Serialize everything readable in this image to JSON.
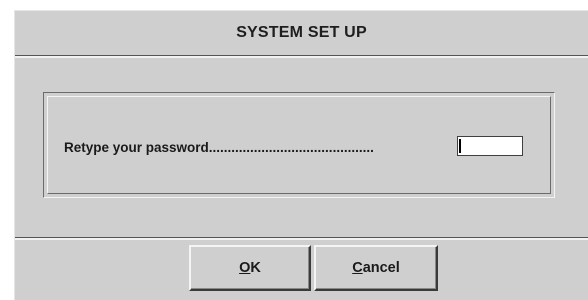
{
  "dialog": {
    "title": "SYSTEM SET UP",
    "prompt_label": "Retype your password............................................",
    "password_value": "",
    "buttons": {
      "ok": {
        "mnemonic": "O",
        "rest": "K"
      },
      "cancel": {
        "mnemonic": "C",
        "rest": "ancel"
      }
    }
  },
  "colors": {
    "dialog_background": "#cfcfcf",
    "input_background": "#ffffff",
    "text": "#1a1a1a"
  }
}
